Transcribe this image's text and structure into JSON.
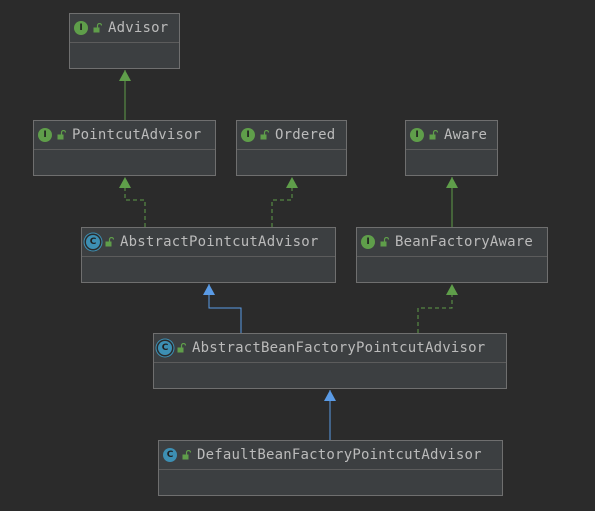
{
  "diagram": {
    "nodes": [
      {
        "id": "advisor",
        "name": "Advisor",
        "kind": "interface",
        "kind_letter": "I"
      },
      {
        "id": "pointcut-advisor",
        "name": "PointcutAdvisor",
        "kind": "interface",
        "kind_letter": "I"
      },
      {
        "id": "ordered",
        "name": "Ordered",
        "kind": "interface",
        "kind_letter": "I"
      },
      {
        "id": "aware",
        "name": "Aware",
        "kind": "interface",
        "kind_letter": "I"
      },
      {
        "id": "abstract-pointcut-advisor",
        "name": "AbstractPointcutAdvisor",
        "kind": "abstract class",
        "kind_letter": "C"
      },
      {
        "id": "bean-factory-aware",
        "name": "BeanFactoryAware",
        "kind": "interface",
        "kind_letter": "I"
      },
      {
        "id": "abstract-bean-factory-pointcut-advisor",
        "name": "AbstractBeanFactoryPointcutAdvisor",
        "kind": "abstract class",
        "kind_letter": "C"
      },
      {
        "id": "default-bean-factory-pointcut-advisor",
        "name": "DefaultBeanFactoryPointcutAdvisor",
        "kind": "class",
        "kind_letter": "C"
      }
    ],
    "edges": [
      {
        "from": "pointcut-advisor",
        "to": "advisor",
        "type": "extends-interface"
      },
      {
        "from": "abstract-pointcut-advisor",
        "to": "pointcut-advisor",
        "type": "implements"
      },
      {
        "from": "abstract-pointcut-advisor",
        "to": "ordered",
        "type": "implements"
      },
      {
        "from": "bean-factory-aware",
        "to": "aware",
        "type": "extends-interface"
      },
      {
        "from": "abstract-bean-factory-pointcut-advisor",
        "to": "abstract-pointcut-advisor",
        "type": "extends-class"
      },
      {
        "from": "abstract-bean-factory-pointcut-advisor",
        "to": "bean-factory-aware",
        "type": "implements"
      },
      {
        "from": "default-bean-factory-pointcut-advisor",
        "to": "abstract-bean-factory-pointcut-advisor",
        "type": "extends-class"
      }
    ],
    "colors": {
      "background": "#2b2b2b",
      "interface_edge": "#5f9e4a",
      "class_edge": "#5a9be6",
      "interface_icon": "#5f9e4a",
      "class_icon": "#3d8fb3",
      "text": "#bbbbbb"
    }
  }
}
